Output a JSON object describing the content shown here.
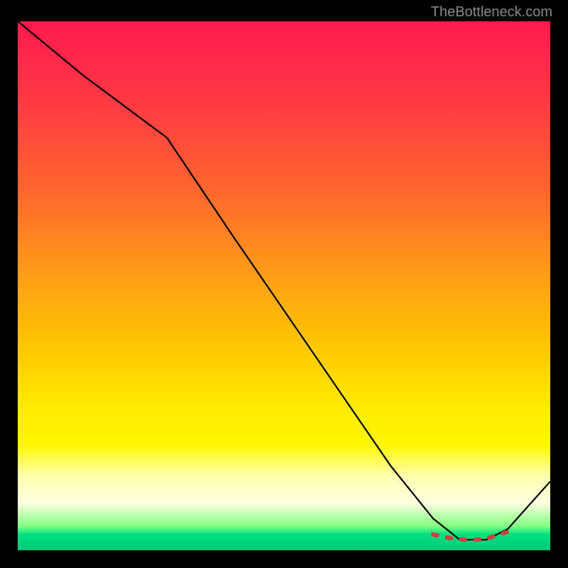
{
  "attribution": "TheBottleneck.com",
  "chart_data": {
    "type": "line",
    "title": "",
    "xlabel": "",
    "ylabel": "",
    "xlim": [
      0,
      100
    ],
    "ylim": [
      0,
      100
    ],
    "series": [
      {
        "name": "curve",
        "x": [
          0,
          12,
          20,
          28,
          40,
          55,
          70,
          78,
          83,
          88,
          92,
          100
        ],
        "values": [
          100,
          90,
          84,
          78,
          60,
          38,
          16,
          6,
          2,
          2,
          4,
          13
        ]
      },
      {
        "name": "optimal-range-markers",
        "x": [
          78,
          80,
          82,
          84,
          86,
          88,
          90,
          92
        ],
        "values": [
          3,
          2.5,
          2.2,
          2,
          2,
          2.2,
          2.8,
          3.5
        ]
      }
    ],
    "gradient_stops": [
      {
        "pos": 0,
        "color": "#ff1a4d"
      },
      {
        "pos": 50,
        "color": "#ffaa10"
      },
      {
        "pos": 80,
        "color": "#fff800"
      },
      {
        "pos": 97,
        "color": "#00e080"
      }
    ]
  }
}
